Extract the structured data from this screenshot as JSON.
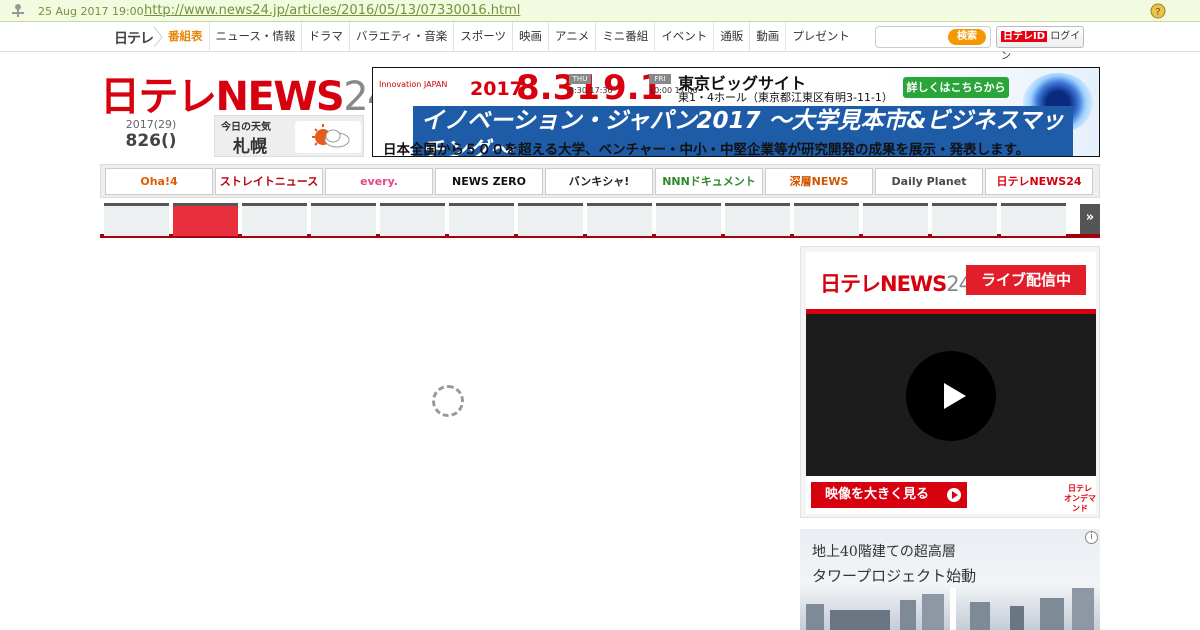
{
  "archive": {
    "timestamp": "25 Aug 2017 19:00",
    "url": "http://www.news24.jp/articles/2016/05/13/07330016.html"
  },
  "global_nav": {
    "logo": "日テレ",
    "items": [
      "番組表",
      "ニュース・情報",
      "ドラマ",
      "バラエティ・音楽",
      "スポーツ",
      "映画",
      "アニメ",
      "ミニ番組",
      "イベント",
      "通販",
      "動画",
      "プレゼント"
    ],
    "active_index": 0,
    "search_button": "検索",
    "search_placeholder": "",
    "login_id": "日テレID",
    "login_label": "ログイン"
  },
  "brand": {
    "logo_text": "日テレNEWS",
    "logo_num": "24"
  },
  "date": {
    "year": "2017(29)",
    "day": "826()"
  },
  "weather": {
    "label": "今日の天気",
    "city": "札幌",
    "icon": "sun-cloud-icon"
  },
  "top_ad": {
    "small": "Innovation JAPAN",
    "year": "2017",
    "date1": "8.31",
    "day1": "THU",
    "time1": "9:30 17:30",
    "date2": "9.1",
    "day2": "FRI",
    "time2": "10:00 17:00",
    "venue": "東京ビッグサイト",
    "hall": "東1・4ホール（東京都江東区有明3-11-1）",
    "detail": "詳しくはこちらから",
    "headline": "イノベーション・ジャパン2017 ～大学見本市&ビジネスマッチング～",
    "sub": "日本全国から５００を超える大学、ベンチャー・中小・中堅企業等が研究開発の成果を展示・発表します。"
  },
  "programs": [
    {
      "label": "Oha!4",
      "color": "#e05a00"
    },
    {
      "label": "ストレイトニュース",
      "color": "#b5000c"
    },
    {
      "label": "every.",
      "color": "#e6458a"
    },
    {
      "label": "NEWS ZERO",
      "color": "#111111"
    },
    {
      "label": "バンキシャ!",
      "color": "#222222"
    },
    {
      "label": "NNNドキュメント",
      "color": "#2a8a2a"
    },
    {
      "label": "深層NEWS",
      "color": "#d45500"
    },
    {
      "label": "Daily Planet",
      "color": "#4a4a4a"
    },
    {
      "label": "日テレNEWS24",
      "color": "#d7000f"
    }
  ],
  "tabs": {
    "count": 14,
    "active_index": 1,
    "next": "»"
  },
  "live": {
    "logo_text": "日テレNEWS",
    "logo_num": "24",
    "badge": "ライブ配信中",
    "big_button": "映像を大きく見る",
    "footer_logo": "日テレ\nオンデマンド"
  },
  "bottom_ad": {
    "line1": "地上40階建ての超高層",
    "line2": "タワープロジェクト始動",
    "info": "i"
  }
}
